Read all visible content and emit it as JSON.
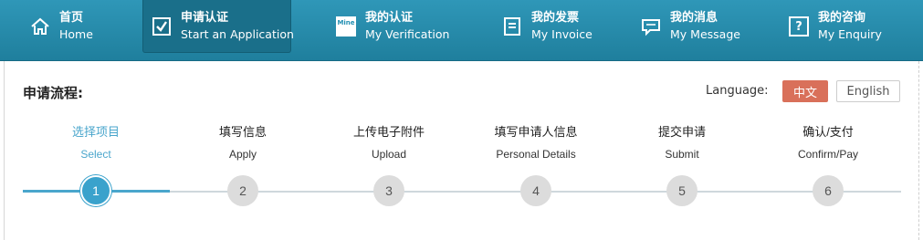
{
  "nav": {
    "items": [
      {
        "zh": "首页",
        "en": "Home",
        "icon": "home-icon"
      },
      {
        "zh": "申请认证",
        "en": "Start an Application",
        "icon": "checkbox-icon"
      },
      {
        "zh": "我的认证",
        "en": "My Verification",
        "icon": "mine-icon",
        "icon_text": "Mine"
      },
      {
        "zh": "我的发票",
        "en": "My Invoice",
        "icon": "invoice-icon"
      },
      {
        "zh": "我的消息",
        "en": "My Message",
        "icon": "message-icon"
      },
      {
        "zh": "我的咨询",
        "en": "My Enquiry",
        "icon": "question-icon",
        "icon_text": "?"
      }
    ],
    "active_index": 1
  },
  "flow": {
    "title": "申请流程:",
    "language_label": "Language:",
    "lang_zh": "中文",
    "lang_en": "English",
    "selected_language": "中文",
    "current_step": 1,
    "steps": [
      {
        "zh": "选择项目",
        "en": "Select",
        "num": "1"
      },
      {
        "zh": "填写信息",
        "en": "Apply",
        "num": "2"
      },
      {
        "zh": "上传电子附件",
        "en": "Upload",
        "num": "3"
      },
      {
        "zh": "填写申请人信息",
        "en": "Personal Details",
        "num": "4"
      },
      {
        "zh": "提交申请",
        "en": "Submit",
        "num": "5"
      },
      {
        "zh": "确认/支付",
        "en": "Confirm/Pay",
        "num": "6"
      }
    ]
  },
  "colors": {
    "nav_bg": "#2490b3",
    "accent": "#4aa6cc",
    "lang_active": "#d9705a"
  }
}
